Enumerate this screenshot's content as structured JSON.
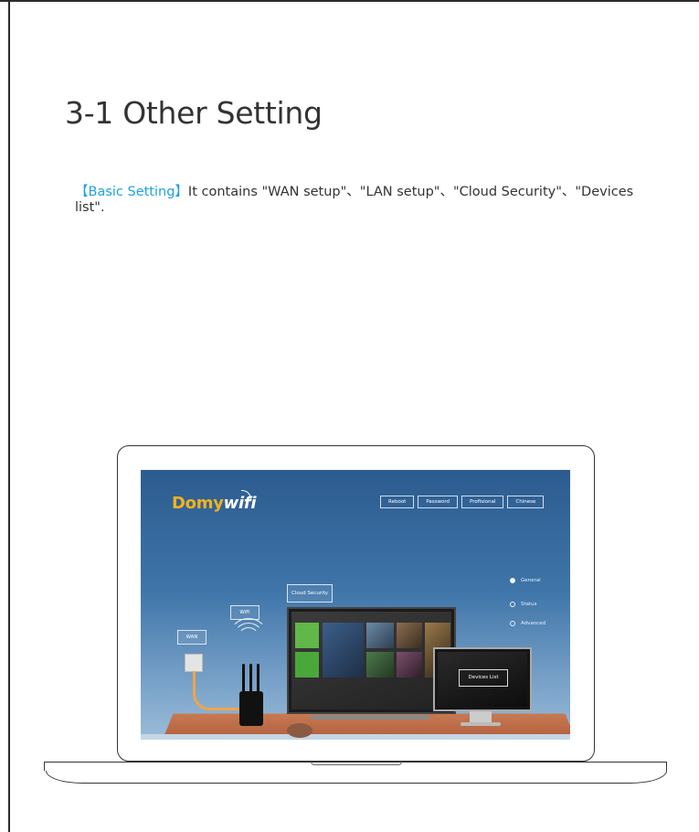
{
  "page": {
    "title": "3-1 Other Setting",
    "intro_highlight": "【Basic Setting】",
    "intro_text": "It contains \"WAN setup\"、\"LAN setup\"、\"Cloud Security\"、\"Devices list\"."
  },
  "screen": {
    "logo_part1": "Domy",
    "logo_part2": "wifi",
    "nav": [
      "Reboot",
      "Password",
      "Profisional",
      "Chinese"
    ],
    "side_menu": [
      {
        "label": "General",
        "active": true
      },
      {
        "label": "Status",
        "active": false
      },
      {
        "label": "Advanced",
        "active": false
      }
    ],
    "labels": {
      "wan": "WAN",
      "wifi": "WiFi",
      "cloud_security": "Cloud Security",
      "devices_list": "Devices List"
    }
  },
  "colors": {
    "highlight": "#1fa2e0",
    "screen_bg": "#3f75a9",
    "logo_accent": "#f2b21f"
  }
}
